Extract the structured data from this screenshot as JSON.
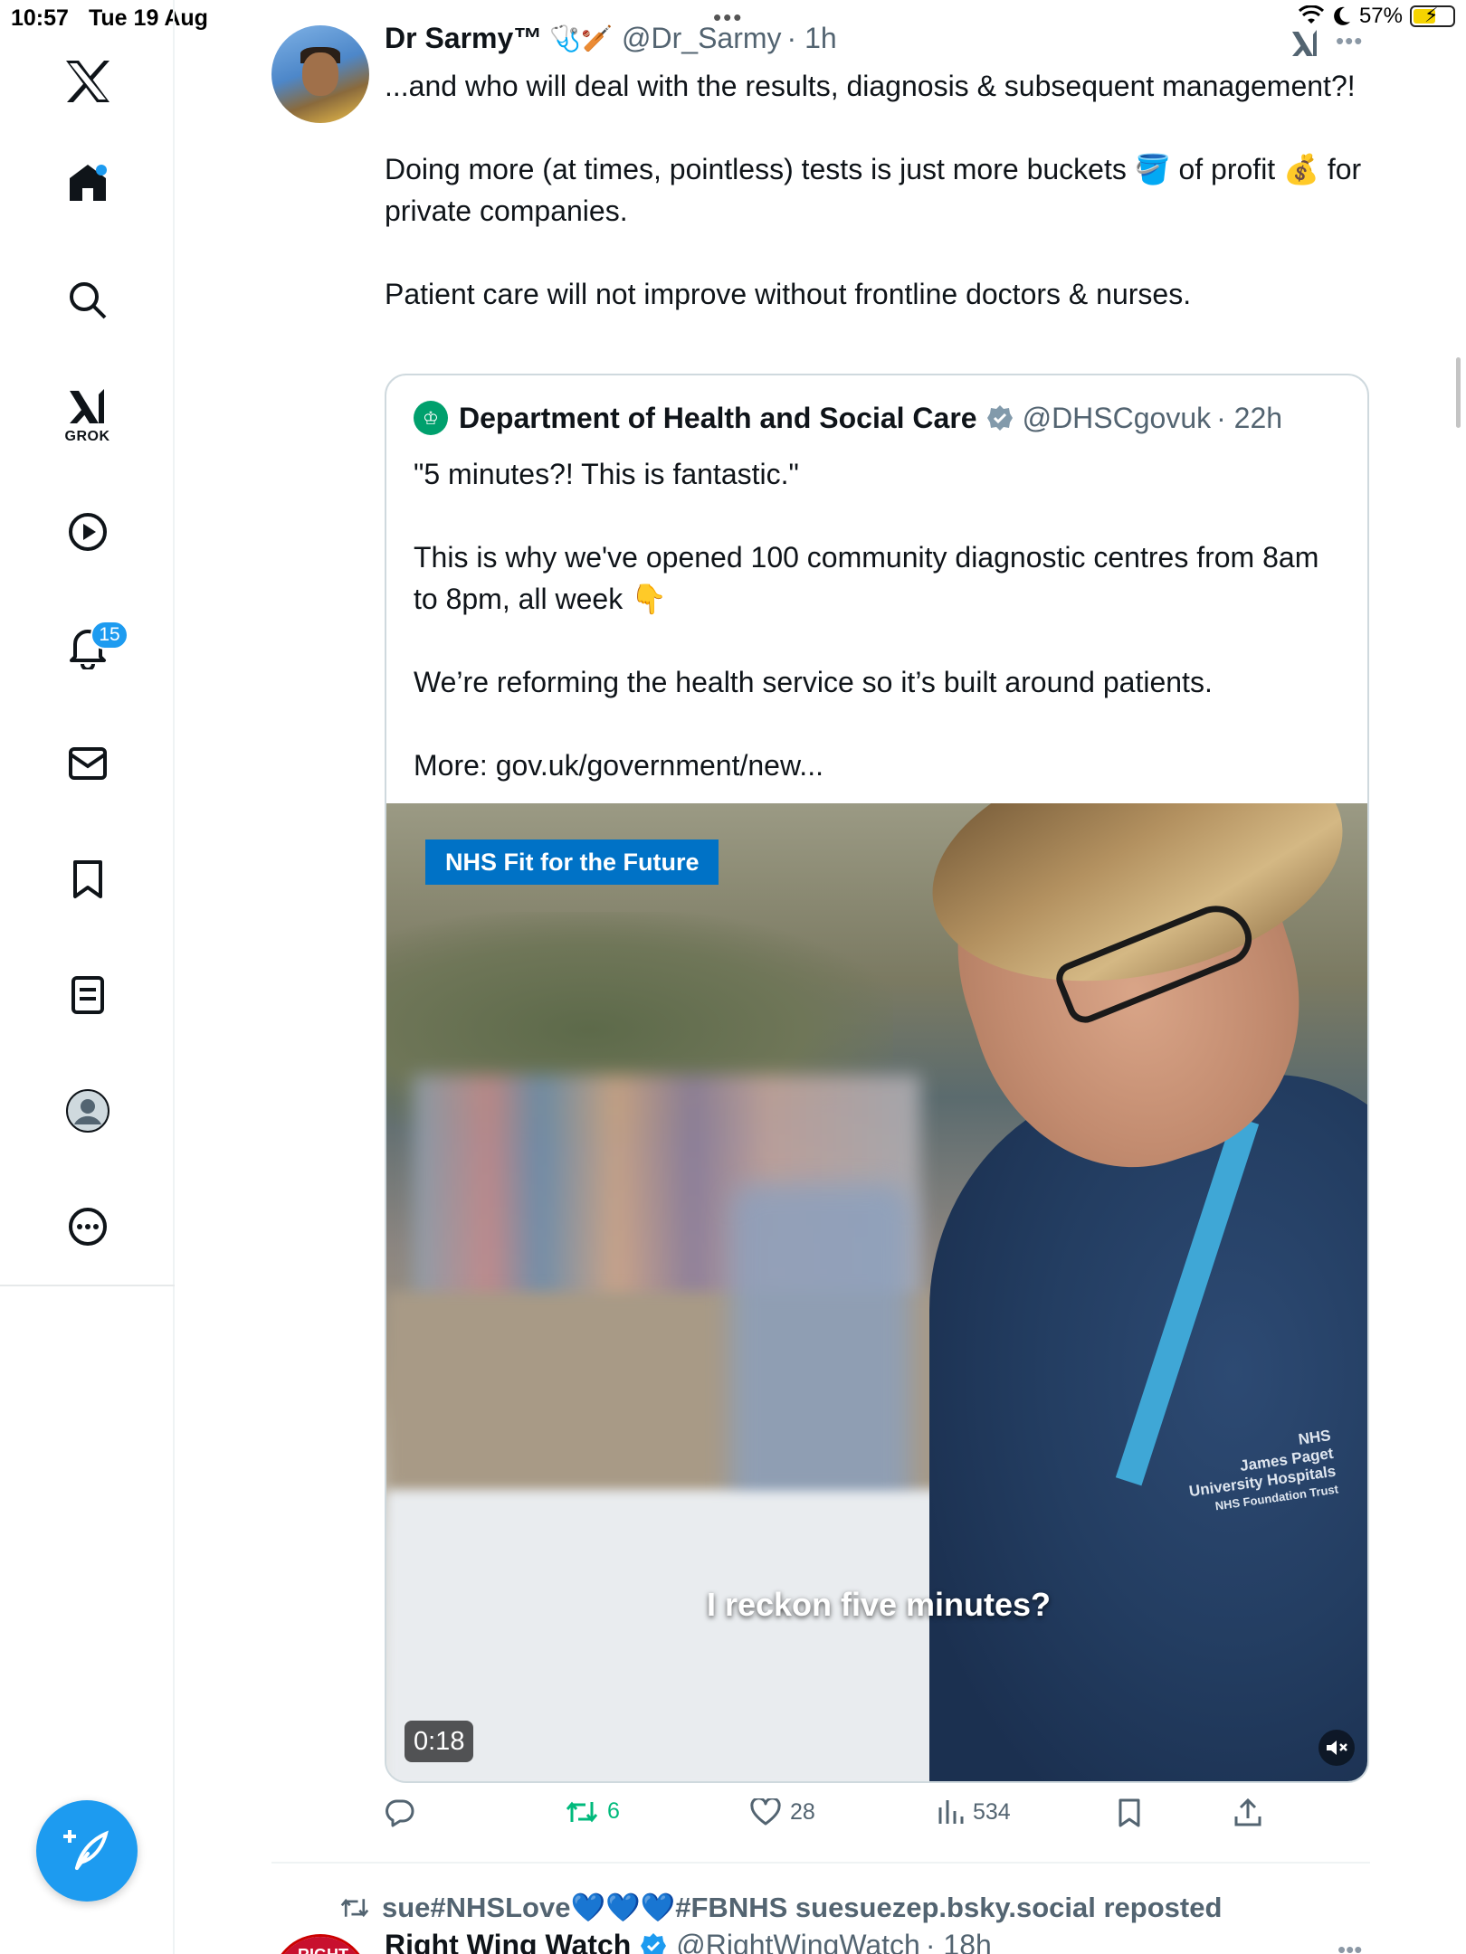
{
  "status_bar": {
    "time": "10:57",
    "date": "Tue 19 Aug",
    "battery": "57%",
    "battery_level": 0.57
  },
  "sidebar": {
    "items": [
      {
        "name": "x-logo",
        "icon": "x-logo-icon"
      },
      {
        "name": "home",
        "icon": "home-icon",
        "has_dot": true
      },
      {
        "name": "search",
        "icon": "search-icon"
      },
      {
        "name": "grok",
        "icon": "grok-icon",
        "label": "GROK"
      },
      {
        "name": "videos",
        "icon": "play-icon"
      },
      {
        "name": "notifications",
        "icon": "bell-icon",
        "badge": "15"
      },
      {
        "name": "messages",
        "icon": "mail-icon"
      },
      {
        "name": "bookmarks",
        "icon": "bookmark-icon"
      },
      {
        "name": "lists",
        "icon": "list-icon"
      },
      {
        "name": "profile",
        "icon": "profile-icon"
      },
      {
        "name": "more",
        "icon": "more-icon"
      }
    ],
    "accent": "#1d9bf0"
  },
  "tweet": {
    "author_name": "Dr Sarmy™",
    "author_emoji": "🩺🏏",
    "handle": "@Dr_Sarmy",
    "time": "· 1h",
    "text": "...and who will deal with the results, diagnosis & subsequent management?!\n\nDoing more (at times, pointless) tests is just more buckets 🪣 of profit 💰 for private companies.\n\nPatient care will not improve without frontline doctors & nurses.",
    "quote": {
      "author_name": "Department of Health and Social Care",
      "handle": "@DHSCgovuk",
      "time": "· 22h",
      "text": "\"5 minutes?! This is fantastic.\"\n\nThis is why we've opened 100 community diagnostic centres from 8am to 8pm, all week 👇\n\nWe’re reforming the health service so it’s built around patients.\n\nMore: gov.uk/government/new...",
      "video": {
        "tag": "NHS Fit for the Future",
        "caption": "I reckon five minutes?",
        "duration": "0:18",
        "badge_lines": [
          "NHS",
          "James Paget",
          "University Hospitals",
          "NHS Foundation Trust"
        ]
      }
    },
    "actions": {
      "reply_count": "",
      "retweet_count": "6",
      "like_count": "28",
      "views_count": "534"
    }
  },
  "next_tweet": {
    "repost_text": "sue#NHSLove💙💙💙#FBNHS suesuezep.bsky.social reposted",
    "author_name": "Right Wing Watch",
    "handle": "@RightWingWatch",
    "time": "· 18h",
    "avatar_text": "RIGHT"
  }
}
